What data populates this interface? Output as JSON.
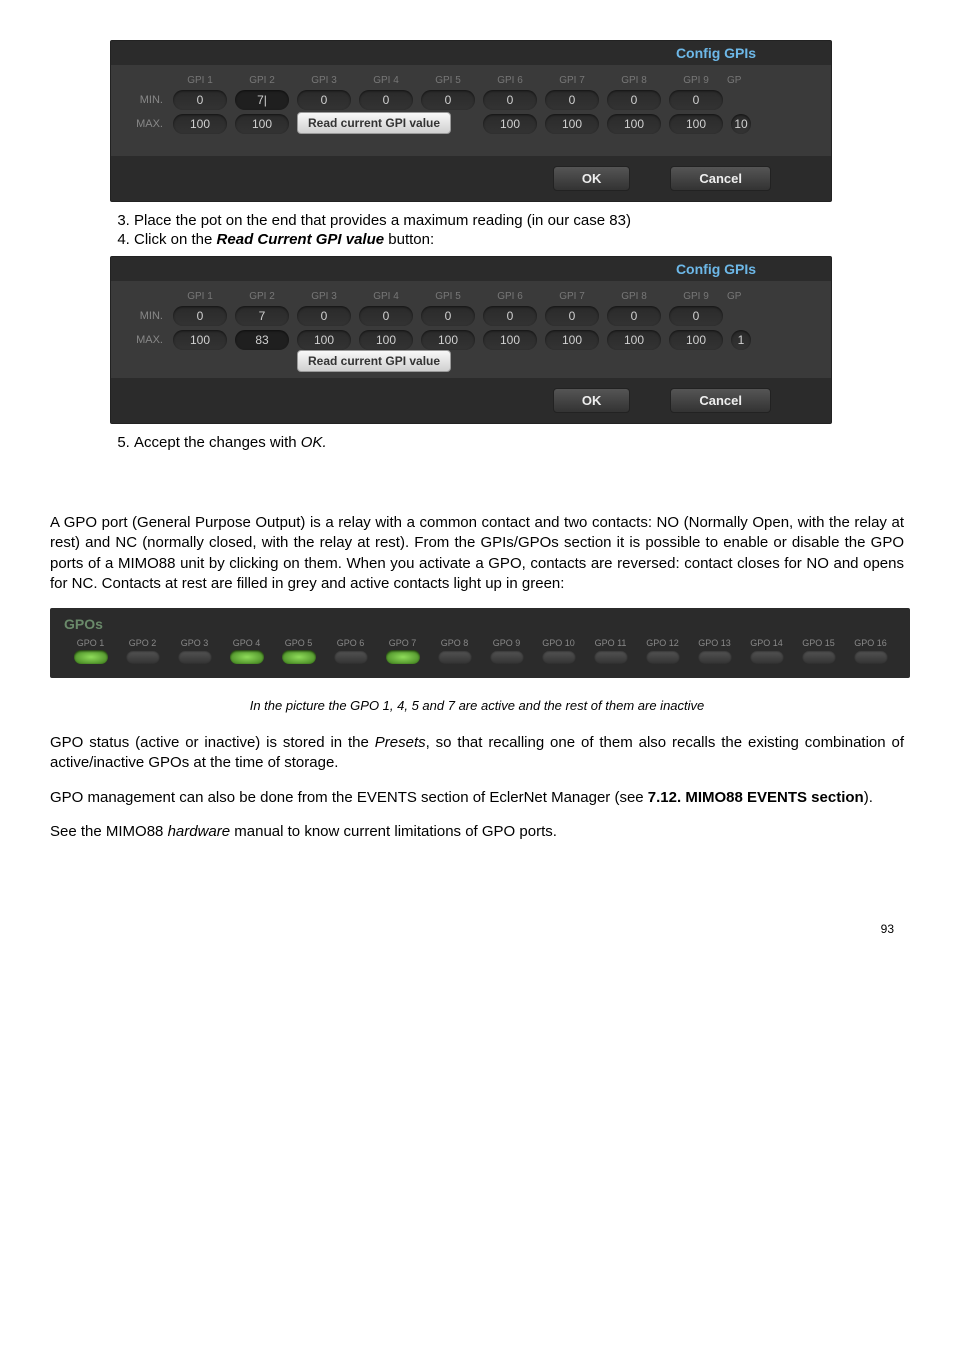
{
  "dialog1": {
    "title": "Config GPIs",
    "headers": [
      "GPI 1",
      "GPI 2",
      "GPI 3",
      "GPI 4",
      "GPI 5",
      "GPI 6",
      "GPI 7",
      "GPI 8",
      "GPI 9",
      "GP"
    ],
    "min_label": "MIN.",
    "max_label": "MAX.",
    "min": [
      "0",
      "7|",
      "0",
      "0",
      "0",
      "0",
      "0",
      "0",
      "0"
    ],
    "max": [
      "100",
      "100",
      "",
      "",
      "",
      "100",
      "100",
      "100",
      "100",
      "10"
    ],
    "read_btn": "Read current GPI value",
    "ok": "OK",
    "cancel": "Cancel"
  },
  "steps_a": {
    "s3": "Place the pot on the end that provides a maximum reading (in our case 83)",
    "s4_pre": "Click on the ",
    "s4_b": "Read Current GPI value",
    "s4_post": " button:"
  },
  "dialog2": {
    "title": "Config GPIs",
    "headers": [
      "GPI 1",
      "GPI 2",
      "GPI 3",
      "GPI 4",
      "GPI 5",
      "GPI 6",
      "GPI 7",
      "GPI 8",
      "GPI 9",
      "GP"
    ],
    "min_label": "MIN.",
    "max_label": "MAX.",
    "min": [
      "0",
      "7",
      "0",
      "0",
      "0",
      "0",
      "0",
      "0",
      "0"
    ],
    "max": [
      "100",
      "83",
      "100",
      "100",
      "100",
      "100",
      "100",
      "100",
      "100",
      "1"
    ],
    "read_btn": "Read current GPI value",
    "ok": "OK",
    "cancel": "Cancel"
  },
  "steps_b": {
    "s5_pre": "Accept the changes with ",
    "s5_i": "OK."
  },
  "para1": "A GPO port (General Purpose Output) is a relay with a common contact and two contacts: NO (Normally Open, with the relay at rest) and NC (normally closed, with the relay at rest). From the GPIs/GPOs section it is possible to enable or disable the GPO ports of a MIMO88 unit by clicking on them. When you activate a GPO, contacts are reversed: contact closes for NO and opens for NC. Contacts at rest are filled in grey and active contacts light up in green:",
  "gpo": {
    "title": "GPOs",
    "items": [
      {
        "label": "GPO 1",
        "on": true
      },
      {
        "label": "GPO 2",
        "on": false
      },
      {
        "label": "GPO 3",
        "on": false
      },
      {
        "label": "GPO 4",
        "on": true
      },
      {
        "label": "GPO 5",
        "on": true
      },
      {
        "label": "GPO 6",
        "on": false
      },
      {
        "label": "GPO 7",
        "on": true
      },
      {
        "label": "GPO 8",
        "on": false
      },
      {
        "label": "GPO 9",
        "on": false
      },
      {
        "label": "GPO 10",
        "on": false
      },
      {
        "label": "GPO 11",
        "on": false
      },
      {
        "label": "GPO 12",
        "on": false
      },
      {
        "label": "GPO 13",
        "on": false
      },
      {
        "label": "GPO 14",
        "on": false
      },
      {
        "label": "GPO 15",
        "on": false
      },
      {
        "label": "GPO 16",
        "on": false
      }
    ]
  },
  "caption": "In the picture the GPO 1, 4, 5 and 7 are active and the rest of them are inactive",
  "para2_pre": "GPO status (active or inactive) is stored in the ",
  "para2_i": "Presets",
  "para2_post": ", so that recalling one of them also recalls the existing combination of active/inactive GPOs at the time of storage.",
  "para3_pre": "GPO management can also be done from the EVENTS section of EclerNet Manager (see ",
  "para3_b": "7.12. MIMO88 EVENTS section",
  "para3_post": ").",
  "para4_pre": "See the MIMO88 ",
  "para4_i": "hardware",
  "para4_post": " manual to know current limitations of GPO ports.",
  "pagenum": "93"
}
